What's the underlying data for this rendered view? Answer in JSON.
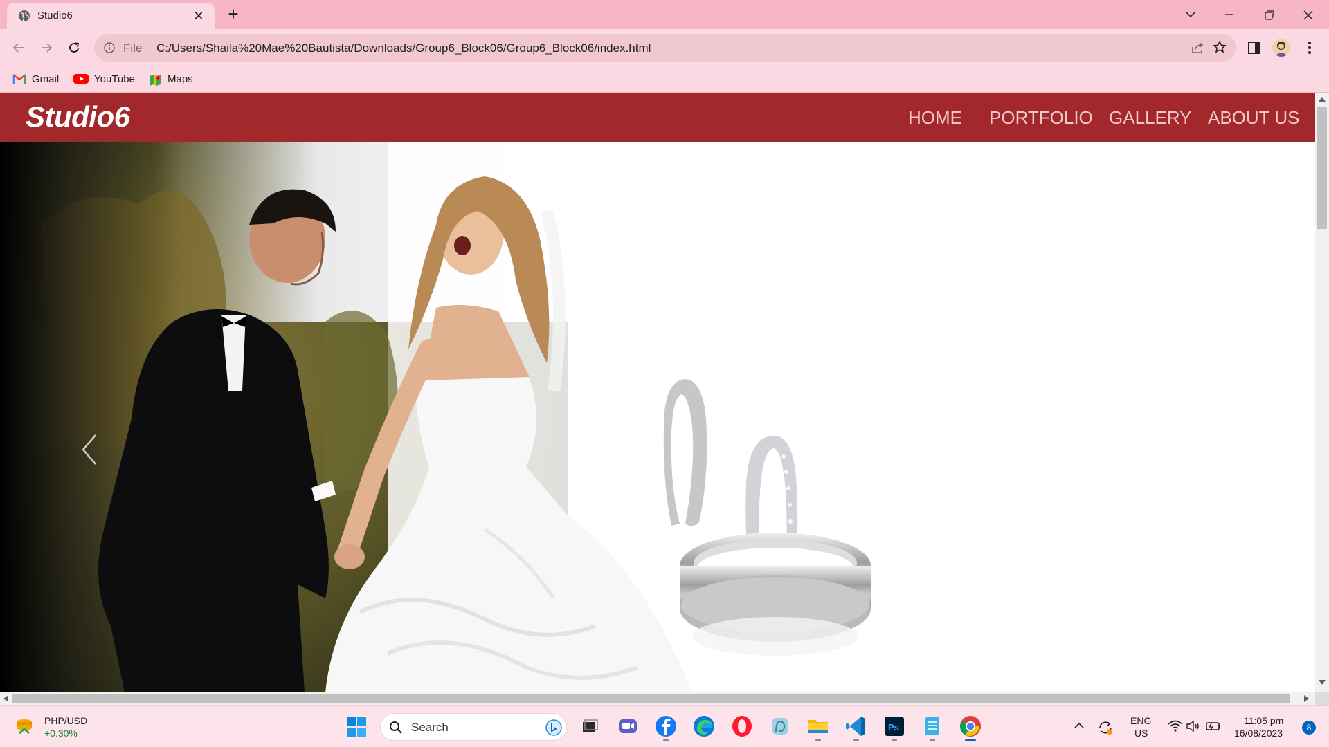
{
  "browser": {
    "tab_title": "Studio6",
    "address_scheme": "File",
    "address_url": "C:/Users/Shaila%20Mae%20Bautista/Downloads/Group6_Block06/Group6_Block06/index.html",
    "bookmarks": [
      {
        "label": "Gmail",
        "icon": "gmail-icon"
      },
      {
        "label": "YouTube",
        "icon": "youtube-icon"
      },
      {
        "label": "Maps",
        "icon": "maps-icon"
      }
    ],
    "colors": {
      "tabbar": "#f7b6c7",
      "toolbar": "#fcd9e2"
    }
  },
  "site": {
    "logo": "Studio6",
    "nav": [
      "HOME",
      "PORTFOLIO",
      "GALLERY",
      "ABOUT US"
    ],
    "colors": {
      "navbar": "#a3282b",
      "nav_text": "#f2c8c9"
    },
    "hero": {
      "image": "wedding couple photo with wedding rings",
      "control": "carousel-previous-arrow"
    }
  },
  "taskbar": {
    "widget_title": "PHP/USD",
    "widget_change": "+0.30%",
    "search_placeholder": "Search",
    "apps": [
      "file-explorer-task-view-icon",
      "meet-icon",
      "facebook-icon",
      "edge-icon",
      "opera-icon",
      "photos-icon",
      "folder-icon",
      "vscode-icon",
      "photoshop-icon",
      "notepad-icon",
      "chrome-icon"
    ],
    "tray": {
      "lang": "ENG",
      "region": "US",
      "time": "11:05 pm",
      "date": "16/08/2023",
      "notifications": "8"
    }
  }
}
